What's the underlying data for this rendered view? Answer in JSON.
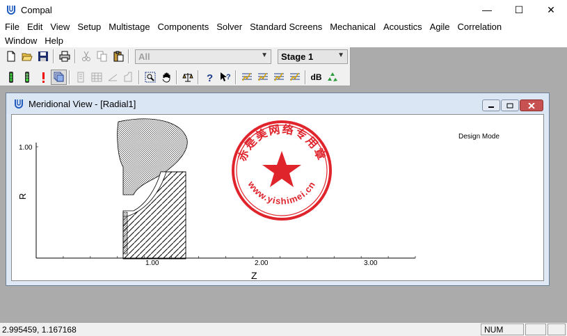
{
  "app": {
    "title": "Compal"
  },
  "window_controls": {
    "minimize": "—",
    "maximize": "☐",
    "close": "✕"
  },
  "menu": {
    "row1": [
      "File",
      "Edit",
      "View",
      "Setup",
      "Multistage",
      "Components",
      "Solver",
      "Standard Screens",
      "Mechanical",
      "Acoustics",
      "Agile",
      "Correlation"
    ],
    "row2": [
      "Window",
      "Help"
    ]
  },
  "toolbar": {
    "component_combo": {
      "value": "All",
      "disabled": true
    },
    "stage_combo": {
      "value": "Stage 1"
    },
    "db_label": "dB"
  },
  "child_window": {
    "title": "Meridional View - [Radial1]",
    "mode_label": "Design Mode"
  },
  "chart_data": {
    "type": "line",
    "title": "",
    "xlabel": "Z",
    "ylabel": "R",
    "x_ticks": [
      "1.00",
      "2.00",
      "3.00"
    ],
    "y_ticks": [
      "1.00"
    ],
    "xlim": [
      0,
      3.5
    ],
    "ylim": [
      0,
      1.07
    ],
    "series": [
      {
        "shape": "volute",
        "fill": "cross-hatch"
      },
      {
        "shape": "impeller-hub",
        "fill": "diagonal-hatch"
      }
    ]
  },
  "stamp": {
    "top_text": "赤是美网络专用章",
    "bottom_text": "www.yishimei.cn",
    "color": "#e0242c"
  },
  "status": {
    "coordinates": "2.995459, 1.167168",
    "num": "NUM"
  },
  "colors": {
    "background": "#ababab",
    "chart_line": "#000000",
    "stamp_red": "#e0242c"
  }
}
